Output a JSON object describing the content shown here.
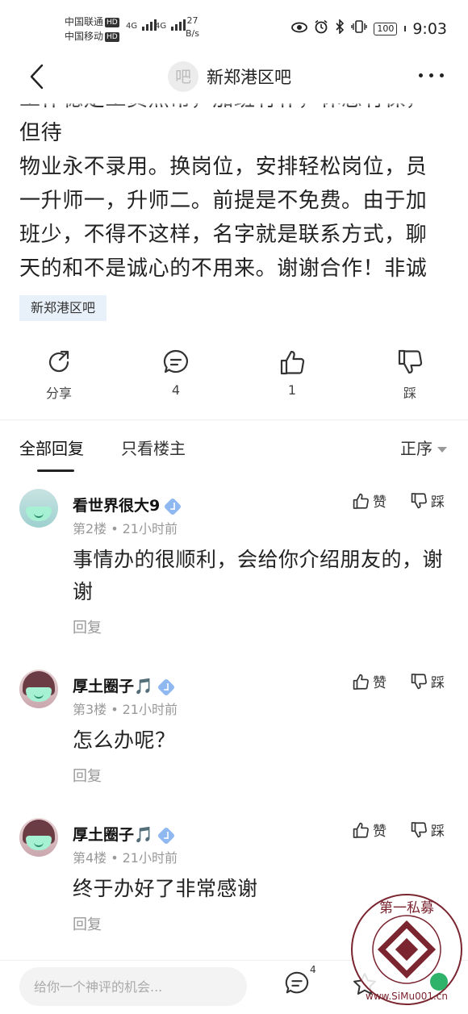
{
  "status_bar": {
    "carrier_1": "中国联通",
    "carrier_2": "中国移动",
    "hd": "HD",
    "network_1": "4G",
    "network_2": "4G",
    "speed_value": "27",
    "speed_unit": "B/s",
    "battery": "100",
    "time": "9:03"
  },
  "header": {
    "avatar_char": "吧",
    "title": "新郑港区吧"
  },
  "post": {
    "text": "物业永不录用。换岗位，安排轻松岗位，员一升师一，升师二。前提是不免费。由于加班少，不得不这样，名字就是联系方式，聊天的和不是诚心的不用来。谢谢合作！非诚勿扰！#(吐舌)",
    "tag": "新郑港区吧"
  },
  "actions": {
    "share": "分享",
    "comments": "4",
    "likes": "1",
    "dislike": "踩"
  },
  "tabs": {
    "all_replies": "全部回复",
    "op_only": "只看楼主",
    "sort": "正序"
  },
  "replies": [
    {
      "username": "看世界很大9",
      "floor": "第2楼",
      "time": "21小时前",
      "content": "事情办的很顺利，会给你介绍朋友的，谢谢",
      "like": "赞",
      "dislike": "踩",
      "reply": "回复"
    },
    {
      "username": "厚土圈子🎵",
      "floor": "第3楼",
      "time": "21小时前",
      "content": "怎么办呢？",
      "like": "赞",
      "dislike": "踩",
      "reply": "回复"
    },
    {
      "username": "厚土圈子🎵",
      "floor": "第4楼",
      "time": "21小时前",
      "content": "终于办好了非常感谢",
      "like": "赞",
      "dislike": "踩",
      "reply": "回复"
    }
  ],
  "bottom_bar": {
    "placeholder": "给你一个神评的机会...",
    "comment_count": "4"
  },
  "watermark": {
    "text": "第一私募",
    "url": "www.SiMu001.cn"
  }
}
